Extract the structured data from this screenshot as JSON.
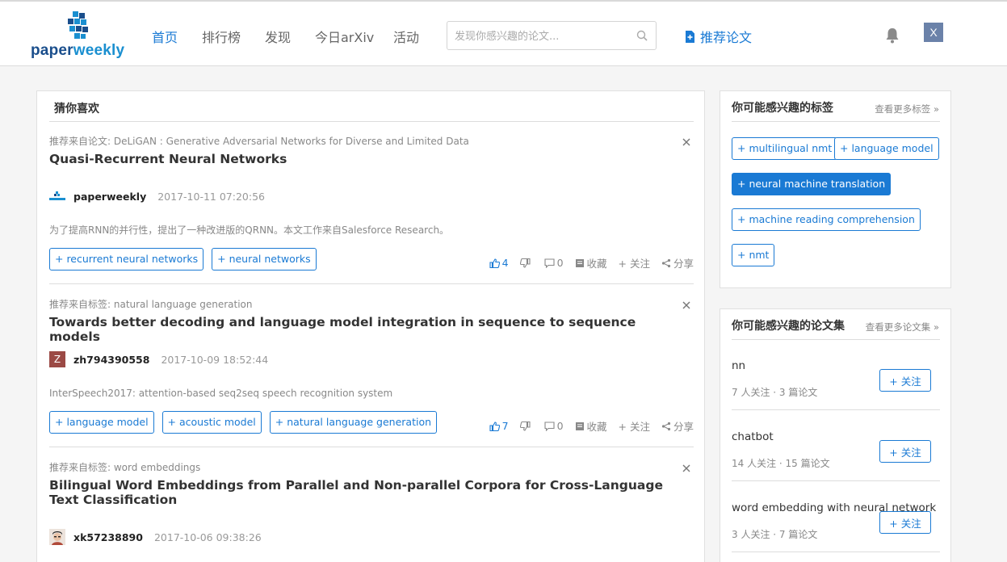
{
  "brand": {
    "part1": "paper",
    "part2": "weekly"
  },
  "nav": [
    {
      "label": "首页",
      "active": true
    },
    {
      "label": "排行榜",
      "active": false
    },
    {
      "label": "发现",
      "active": false
    },
    {
      "label": "今日arXiv",
      "active": false
    },
    {
      "label": "活动",
      "active": false
    }
  ],
  "search": {
    "placeholder": "发现你感兴趣的论文...",
    "value": ""
  },
  "recommend_label": "推荐论文",
  "user_avatar": "X",
  "feed": {
    "title": "猜你喜欢",
    "items": [
      {
        "source": "推荐来自论文: DeLiGAN : Generative Adversarial Networks for Diverse and Limited Data",
        "title": "Quasi-Recurrent Neural Networks",
        "author": "paperweekly",
        "time": "2017-10-11 07:20:56",
        "summary": "为了提高RNN的并行性，提出了一种改进版的QRNN。本文工作来自Salesforce Research。",
        "tags": [
          "+ recurrent neural networks",
          "+ neural networks"
        ],
        "likes": "4",
        "comments": "0",
        "collect": "收藏",
        "follow": "+ 关注",
        "share": "分享"
      },
      {
        "source": "推荐来自标签: natural language generation",
        "title": "Towards better decoding and language model integration in sequence to sequence models",
        "author": "zh794390558",
        "author_initial": "Z",
        "time": "2017-10-09 18:52:44",
        "summary": "InterSpeech2017: attention-based seq2seq speech recognition system",
        "tags": [
          "+ language model",
          "+ acoustic model",
          "+ natural language generation"
        ],
        "likes": "7",
        "comments": "0",
        "collect": "收藏",
        "follow": "+ 关注",
        "share": "分享"
      },
      {
        "source": "推荐来自标签: word embeddings",
        "title": "Bilingual Word Embeddings from Parallel and Non-parallel Corpora for Cross-Language Text Classification",
        "author": "xk57238890",
        "time": "2017-10-06 09:38:26"
      }
    ]
  },
  "tags_panel": {
    "title": "你可能感兴趣的标签",
    "more": "查看更多标签 »",
    "tags": [
      {
        "label": "+ multilingual nmt",
        "selected": false
      },
      {
        "label": "+ language model",
        "selected": false
      },
      {
        "label": "+ neural machine translation",
        "selected": true
      },
      {
        "label": "+ machine reading comprehension",
        "selected": false
      },
      {
        "label": "+ nmt",
        "selected": false
      }
    ]
  },
  "collections_panel": {
    "title": "你可能感兴趣的论文集",
    "more": "查看更多论文集 »",
    "items": [
      {
        "name": "nn",
        "stats": "7 人关注 · 3 篇论文",
        "follow": "+ 关注"
      },
      {
        "name": "chatbot",
        "stats": "14 人关注 · 15 篇论文",
        "follow": "+ 关注"
      },
      {
        "name": "word embedding with neural network",
        "stats": "3 人关注 · 7 篇论文",
        "follow": "+ 关注"
      }
    ]
  },
  "colors": {
    "accent": "#1a7ad4",
    "brand_dark": "#1a4e8c",
    "brand_light": "#1a8fd0"
  }
}
